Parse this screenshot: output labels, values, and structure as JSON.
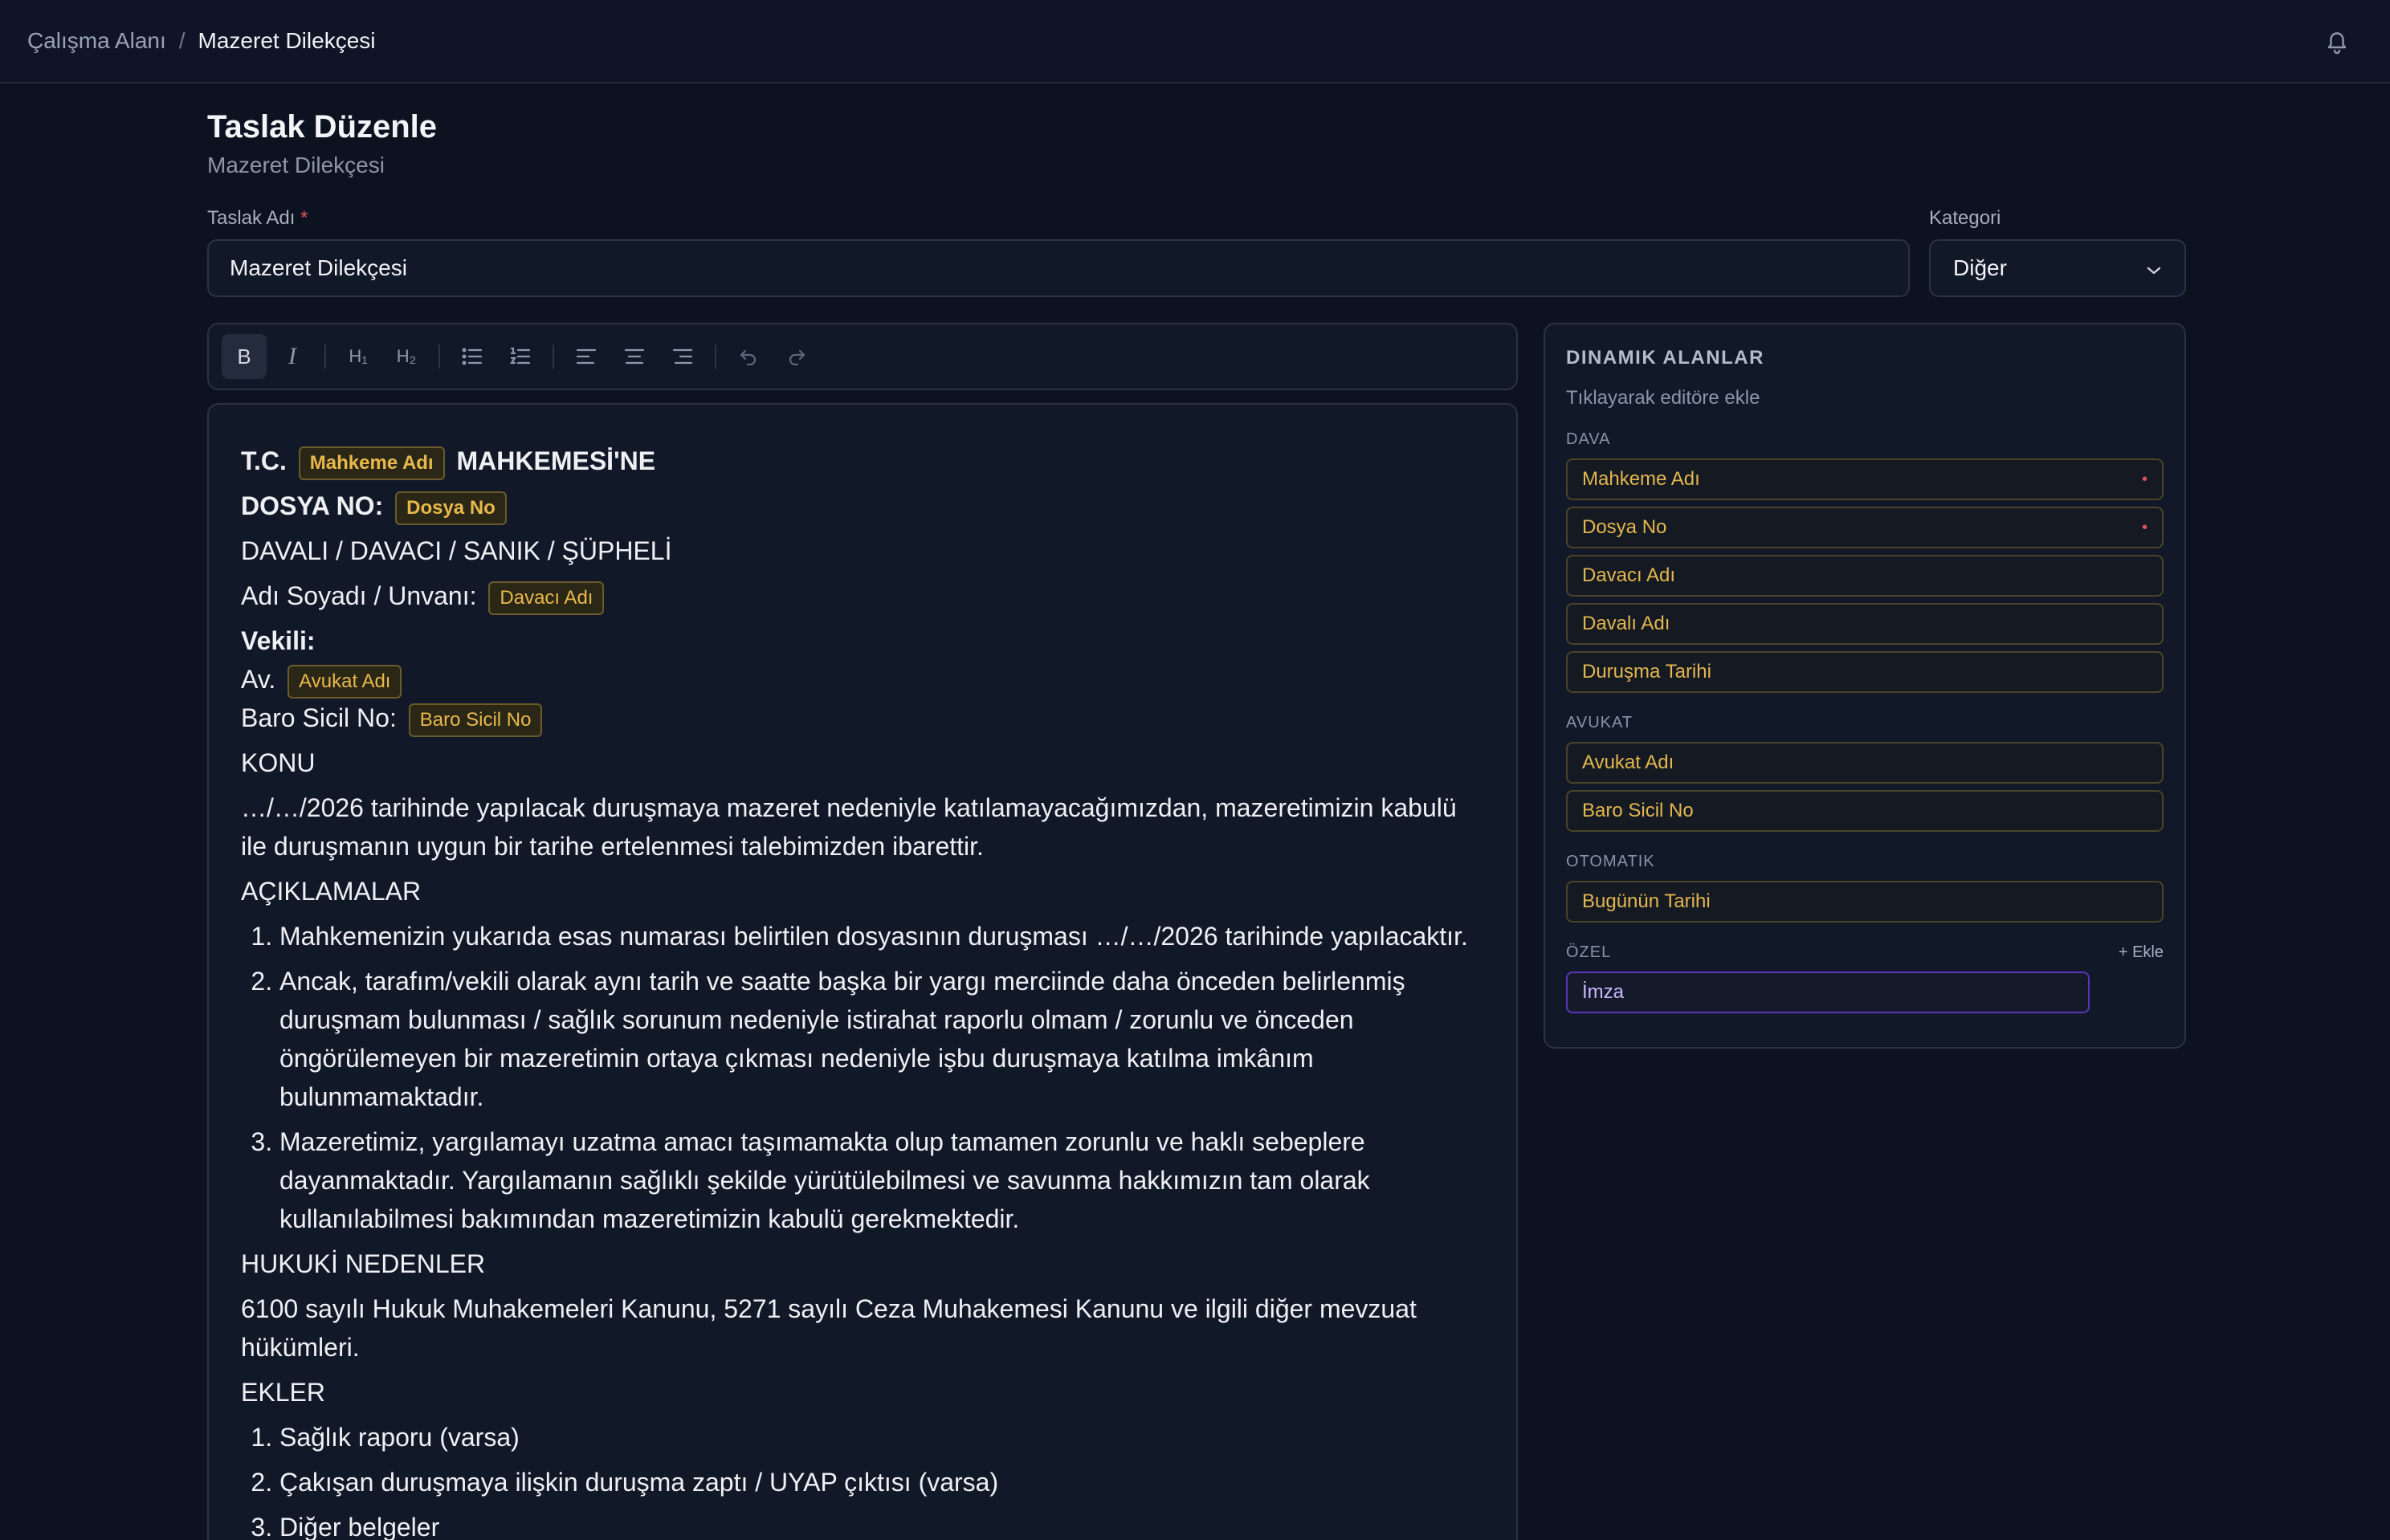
{
  "breadcrumb": {
    "parent": "Çalışma Alanı",
    "separator": "/",
    "current": "Mazeret Dilekçesi"
  },
  "header": {
    "title": "Taslak Düzenle",
    "subtitle": "Mazeret Dilekçesi"
  },
  "form": {
    "name_label": "Taslak Adı",
    "name_required": "*",
    "name_value": "Mazeret Dilekçesi",
    "category_label": "Kategori",
    "category_value": "Diğer"
  },
  "toolbar": {
    "bold": "B",
    "italic": "I",
    "h1": "H₁",
    "h2": "H₂"
  },
  "editor": {
    "tc": "T.C.",
    "court_chip": "Mahkeme Adı",
    "court_suffix": "MAHKEMESİ'NE",
    "file_label": "DOSYA NO:",
    "file_chip": "Dosya No",
    "parties": "DAVALI / DAVACI / SANIK / ŞÜPHELİ",
    "name_label": "Adı Soyadı / Unvanı:",
    "plaintiff_chip": "Davacı Adı",
    "attorney_label": "Vekili:",
    "av_label": "Av.",
    "lawyer_chip": "Avukat Adı",
    "bar_label": "Baro Sicil No:",
    "bar_chip": "Baro Sicil No",
    "subject_heading": "KONU",
    "subject_text": "…/…/2026 tarihinde yapılacak duruşmaya mazeret nedeniyle katılamayacağımızdan, mazeretimizin kabulü ile duruşmanın uygun bir tarihe ertelenmesi talebimizden ibarettir.",
    "explanations_heading": "AÇIKLAMALAR",
    "explanations": [
      "Mahkemenizin yukarıda esas numarası belirtilen dosyasının duruşması …/…/2026 tarihinde yapılacaktır.",
      "Ancak, tarafım/vekili olarak aynı tarih ve saatte başka bir yargı merciinde daha önceden belirlenmiş duruşmam bulunması / sağlık sorunum nedeniyle istirahat raporlu olmam / zorunlu ve önceden öngörülemeyen bir mazeretimin ortaya çıkması nedeniyle işbu duruşmaya katılma imkânım bulunmamaktadır.",
      "Mazeretimiz, yargılamayı uzatma amacı taşımamakta olup tamamen zorunlu ve haklı sebeplere dayanmaktadır. Yargılamanın sağlıklı şekilde yürütülebilmesi ve savunma hakkımızın tam olarak kullanılabilmesi bakımından mazeretimizin kabulü gerekmektedir."
    ],
    "legal_heading": "HUKUKİ NEDENLER",
    "legal_text": "6100 sayılı Hukuk Muhakemeleri Kanunu, 5271 sayılı Ceza Muhakemesi Kanunu ve ilgili diğer mevzuat hükümleri.",
    "attachments_heading": "EKLER",
    "attachments": [
      "Sağlık raporu (varsa)",
      "Çakışan duruşmaya ilişkin duruşma zaptı / UYAP çıktısı (varsa)",
      "Diğer belgeler"
    ]
  },
  "panel": {
    "title": "DINAMIK ALANLAR",
    "hint": "Tıklayarak editöre ekle",
    "dava_label": "DAVA",
    "dava_fields": [
      "Mahkeme Adı",
      "Dosya No",
      "Davacı Adı",
      "Davalı Adı",
      "Duruşma Tarihi"
    ],
    "required_mark": "•",
    "avukat_label": "AVUKAT",
    "avukat_fields": [
      "Avukat Adı",
      "Baro Sicil No"
    ],
    "otomatik_label": "OTOMATIK",
    "otomatik_fields": [
      "Bugünün Tarihi"
    ],
    "ozel_label": "ÖZEL",
    "add_label": "+ Ekle",
    "custom_field_value": "İmza"
  },
  "colors": {
    "background": "#0d1220",
    "chip_text": "#e8b84a",
    "required": "#e0505a",
    "custom_border": "#5a35b8"
  }
}
